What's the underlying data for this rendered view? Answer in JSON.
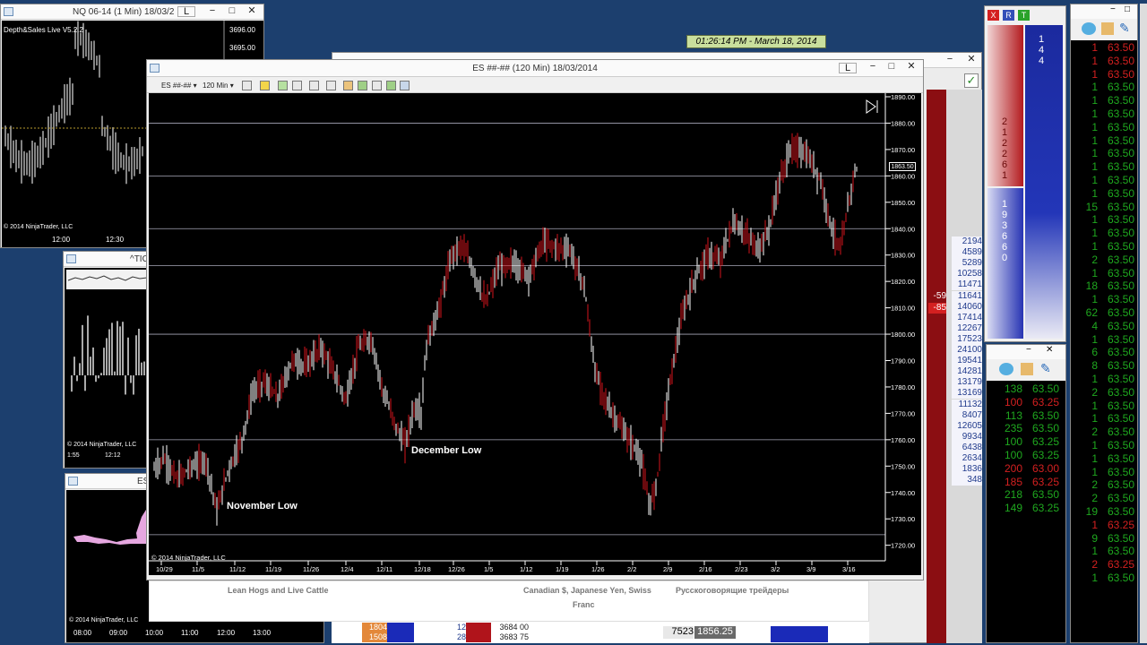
{
  "nq_window": {
    "title": "NQ 06-14 (1 Min)  18/03/2",
    "indicator": "Depth&Sales Live V5.2.2",
    "prices": [
      "3696.00",
      "3695.00"
    ],
    "copyright": "© 2014 NinjaTrader, LLC",
    "times": [
      "12:00",
      "12:30"
    ]
  },
  "tick_window": {
    "title": "^TIC",
    "copyright": "© 2014 NinjaTrader, LLC",
    "times": [
      "1:55",
      "12:12"
    ]
  },
  "es_small_window": {
    "title": "ES",
    "copyright": "© 2014 NinjaTrader, LLC",
    "times": [
      "08:00",
      "09:00",
      "10:00",
      "11:00",
      "12:00",
      "13:00"
    ]
  },
  "clock": "01:26:14 PM - March 18, 2014",
  "main_chart": {
    "title": "ES ##-## (120 Min)  18/03/2014",
    "toolbar": {
      "instrument": "ES ##-##",
      "interval": "120 Min"
    },
    "copyright": "© 2014 NinjaTrader, LLC",
    "annotations": [
      "November Low",
      "December Low"
    ],
    "current_price": "1863.50",
    "y_labels": [
      "1890.00",
      "1880.00",
      "1870.00",
      "1860.00",
      "1850.00",
      "1840.00",
      "1830.00",
      "1820.00",
      "1810.00",
      "1800.00",
      "1790.00",
      "1780.00",
      "1770.00",
      "1760.00",
      "1750.00",
      "1740.00",
      "1730.00",
      "1720.00"
    ],
    "x_labels": [
      "10/29",
      "11/5",
      "11/12",
      "11/19",
      "11/26",
      "12/4",
      "12/11",
      "12/18",
      "12/26",
      "1/5",
      "1/12",
      "1/19",
      "1/26",
      "2/2",
      "2/9",
      "2/16",
      "2/23",
      "3/2",
      "3/9",
      "3/16"
    ]
  },
  "volume_column": [
    "2194",
    "4589",
    "5289",
    "10258",
    "11471",
    "11641",
    "14060",
    "17414",
    "12267",
    "17523",
    "24100",
    "19541",
    "14281",
    "13179",
    "13169",
    "11132",
    "8407",
    "12605",
    "9934",
    "6438",
    "2634",
    "1836",
    "348"
  ],
  "deltas": [
    "-59",
    "-85"
  ],
  "background_texts": {
    "lean_hogs": "Lean Hogs and Live Cattle",
    "cad": "Canadian $, Japanese Yen, Swiss",
    "franc": "Franc",
    "russian": "Русскоговорящие трейдеры"
  },
  "bottom_quotes": [
    "1804",
    "1508",
    "12",
    "28",
    "3684 00",
    "3683 75",
    "7523",
    "1856.25"
  ],
  "right_panel": {
    "buttons": [
      "X",
      "R",
      "T"
    ],
    "ask_digits": "144",
    "mid_digits": "212261",
    "bid_digits": "193660"
  },
  "dom_right": [
    {
      "q": "1",
      "p": "63.50",
      "c": "#d32020"
    },
    {
      "q": "1",
      "p": "63.50",
      "c": "#d32020"
    },
    {
      "q": "1",
      "p": "63.50",
      "c": "#d32020"
    },
    {
      "q": "1",
      "p": "63.50",
      "c": "#1fa81f"
    },
    {
      "q": "1",
      "p": "63.50",
      "c": "#1fa81f"
    },
    {
      "q": "1",
      "p": "63.50",
      "c": "#1fa81f"
    },
    {
      "q": "1",
      "p": "63.50",
      "c": "#1fa81f"
    },
    {
      "q": "1",
      "p": "63.50",
      "c": "#1fa81f"
    },
    {
      "q": "1",
      "p": "63.50",
      "c": "#1fa81f"
    },
    {
      "q": "1",
      "p": "63.50",
      "c": "#1fa81f"
    },
    {
      "q": "1",
      "p": "63.50",
      "c": "#1fa81f"
    },
    {
      "q": "1",
      "p": "63.50",
      "c": "#1fa81f"
    },
    {
      "q": "15",
      "p": "63.50",
      "c": "#1fa81f"
    },
    {
      "q": "1",
      "p": "63.50",
      "c": "#1fa81f"
    },
    {
      "q": "1",
      "p": "63.50",
      "c": "#1fa81f"
    },
    {
      "q": "1",
      "p": "63.50",
      "c": "#1fa81f"
    },
    {
      "q": "2",
      "p": "63.50",
      "c": "#1fa81f"
    },
    {
      "q": "1",
      "p": "63.50",
      "c": "#1fa81f"
    },
    {
      "q": "18",
      "p": "63.50",
      "c": "#1fa81f"
    },
    {
      "q": "1",
      "p": "63.50",
      "c": "#1fa81f"
    },
    {
      "q": "62",
      "p": "63.50",
      "c": "#1fa81f"
    },
    {
      "q": "4",
      "p": "63.50",
      "c": "#1fa81f"
    },
    {
      "q": "1",
      "p": "63.50",
      "c": "#1fa81f"
    },
    {
      "q": "6",
      "p": "63.50",
      "c": "#1fa81f"
    },
    {
      "q": "8",
      "p": "63.50",
      "c": "#1fa81f"
    },
    {
      "q": "1",
      "p": "63.50",
      "c": "#1fa81f"
    },
    {
      "q": "2",
      "p": "63.50",
      "c": "#1fa81f"
    },
    {
      "q": "1",
      "p": "63.50",
      "c": "#1fa81f"
    },
    {
      "q": "1",
      "p": "63.50",
      "c": "#1fa81f"
    },
    {
      "q": "2",
      "p": "63.50",
      "c": "#1fa81f"
    },
    {
      "q": "1",
      "p": "63.50",
      "c": "#1fa81f"
    },
    {
      "q": "1",
      "p": "63.50",
      "c": "#1fa81f"
    },
    {
      "q": "1",
      "p": "63.50",
      "c": "#1fa81f"
    },
    {
      "q": "2",
      "p": "63.50",
      "c": "#1fa81f"
    },
    {
      "q": "2",
      "p": "63.50",
      "c": "#1fa81f"
    },
    {
      "q": "19",
      "p": "63.50",
      "c": "#1fa81f"
    },
    {
      "q": "1",
      "p": "63.25",
      "c": "#d32020"
    },
    {
      "q": "9",
      "p": "63.50",
      "c": "#1fa81f"
    },
    {
      "q": "1",
      "p": "63.50",
      "c": "#1fa81f"
    },
    {
      "q": "2",
      "p": "63.25",
      "c": "#d32020"
    },
    {
      "q": "1",
      "p": "63.50",
      "c": "#1fa81f"
    }
  ],
  "dom_mid": [
    {
      "q": "138",
      "p": "63.50",
      "c": "#1fa81f"
    },
    {
      "q": "100",
      "p": "63.25",
      "c": "#d32020"
    },
    {
      "q": "113",
      "p": "63.50",
      "c": "#1fa81f"
    },
    {
      "q": "235",
      "p": "63.50",
      "c": "#1fa81f"
    },
    {
      "q": "100",
      "p": "63.25",
      "c": "#1fa81f"
    },
    {
      "q": "100",
      "p": "63.25",
      "c": "#1fa81f"
    },
    {
      "q": "200",
      "p": "63.00",
      "c": "#d32020"
    },
    {
      "q": "185",
      "p": "63.25",
      "c": "#d32020"
    },
    {
      "q": "218",
      "p": "63.50",
      "c": "#1fa81f"
    },
    {
      "q": "149",
      "p": "63.25",
      "c": "#1fa81f"
    }
  ],
  "colors": {
    "up": "#ffffff",
    "down": "#d4151b",
    "bg": "#000000",
    "desktop": "#1c3f6e"
  }
}
